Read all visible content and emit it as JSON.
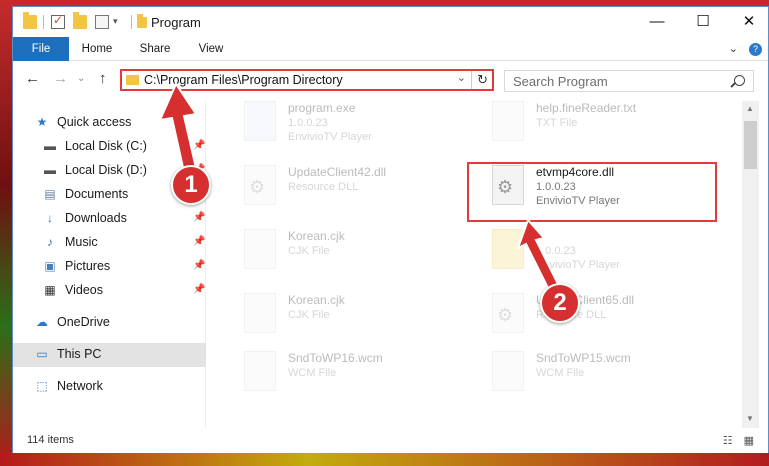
{
  "window": {
    "title": "Program",
    "controls": {
      "minimize": "—",
      "maximize": "☐",
      "close": "✕"
    }
  },
  "ribbon": {
    "tabs": [
      "File",
      "Home",
      "Share",
      "View"
    ],
    "expand_glyph": "⌄",
    "help_glyph": "?"
  },
  "nav": {
    "back": "←",
    "forward": "→",
    "dropdown": "⌄",
    "up": "↑",
    "address": "C:\\Program Files\\Program Directory",
    "address_dropdown": "⌄",
    "refresh": "↻",
    "search_placeholder": "Search Program"
  },
  "sidebar": {
    "items": [
      {
        "label": "Quick access",
        "icon": "star-icon",
        "glyph": "★",
        "color": "#2b79c9",
        "pinned": false
      },
      {
        "label": "Local Disk (C:)",
        "icon": "drive-icon",
        "glyph": "▬",
        "color": "#555",
        "pinned": true
      },
      {
        "label": "Local Disk (D:)",
        "icon": "drive-icon",
        "glyph": "▬",
        "color": "#555",
        "pinned": true
      },
      {
        "label": "Documents",
        "icon": "documents-icon",
        "glyph": "▤",
        "color": "#607d9b",
        "pinned": true
      },
      {
        "label": "Downloads",
        "icon": "download-icon",
        "glyph": "↓",
        "color": "#2b79c9",
        "pinned": true
      },
      {
        "label": "Music",
        "icon": "music-icon",
        "glyph": "♪",
        "color": "#2b79c9",
        "pinned": true
      },
      {
        "label": "Pictures",
        "icon": "pictures-icon",
        "glyph": "▣",
        "color": "#4a7fb7",
        "pinned": true
      },
      {
        "label": "Videos",
        "icon": "videos-icon",
        "glyph": "▦",
        "color": "#333",
        "pinned": true
      },
      {
        "label": "OneDrive",
        "icon": "cloud-icon",
        "glyph": "☁",
        "color": "#2b79c9",
        "pinned": false
      },
      {
        "label": "This PC",
        "icon": "computer-icon",
        "glyph": "▭",
        "color": "#2b79c9",
        "pinned": false,
        "selected": true
      },
      {
        "label": "Network",
        "icon": "network-icon",
        "glyph": "⬚",
        "color": "#2b79c9",
        "pinned": false
      }
    ],
    "pin_glyph": "📌"
  },
  "files": [
    {
      "name": "program.exe",
      "line2": "1.0.0.23",
      "line3": "EnvivioTV Player",
      "kind": "exe",
      "faded": true
    },
    {
      "name": "help.fineReader.txt",
      "line2": "TXT File",
      "line3": "",
      "kind": "txt",
      "faded": true
    },
    {
      "name": "UpdateClient42.dll",
      "line2": "Resource DLL",
      "line3": "",
      "kind": "dll",
      "faded": true
    },
    {
      "name": "etvmp4core.dll",
      "line2": "1.0.0.23",
      "line3": "EnvivioTV Player",
      "kind": "dll",
      "faded": false
    },
    {
      "name": "Korean.cjk",
      "line2": "CJK File",
      "line3": "",
      "kind": "cjk",
      "faded": true
    },
    {
      "name": "",
      "line2": "1.0.0.23",
      "line3": "EnvivioTV Player",
      "kind": "folderish",
      "faded": true
    },
    {
      "name": "Korean.cjk",
      "line2": "CJK File",
      "line3": "",
      "kind": "cjk",
      "faded": true
    },
    {
      "name": "UpdateClient65.dll",
      "line2": "Resource DLL",
      "line3": "",
      "kind": "dll",
      "faded": true
    },
    {
      "name": "SndToWP16.wcm",
      "line2": "WCM File",
      "line3": "",
      "kind": "wcm",
      "faded": true
    },
    {
      "name": "SndToWP15.wcm",
      "line2": "WCM File",
      "line3": "",
      "kind": "wcm",
      "faded": true
    }
  ],
  "status": {
    "item_count": "114 items",
    "view_icons": "☷ ▦"
  },
  "annotations": {
    "step1": "1",
    "step2": "2",
    "color": "#d52f2f"
  }
}
